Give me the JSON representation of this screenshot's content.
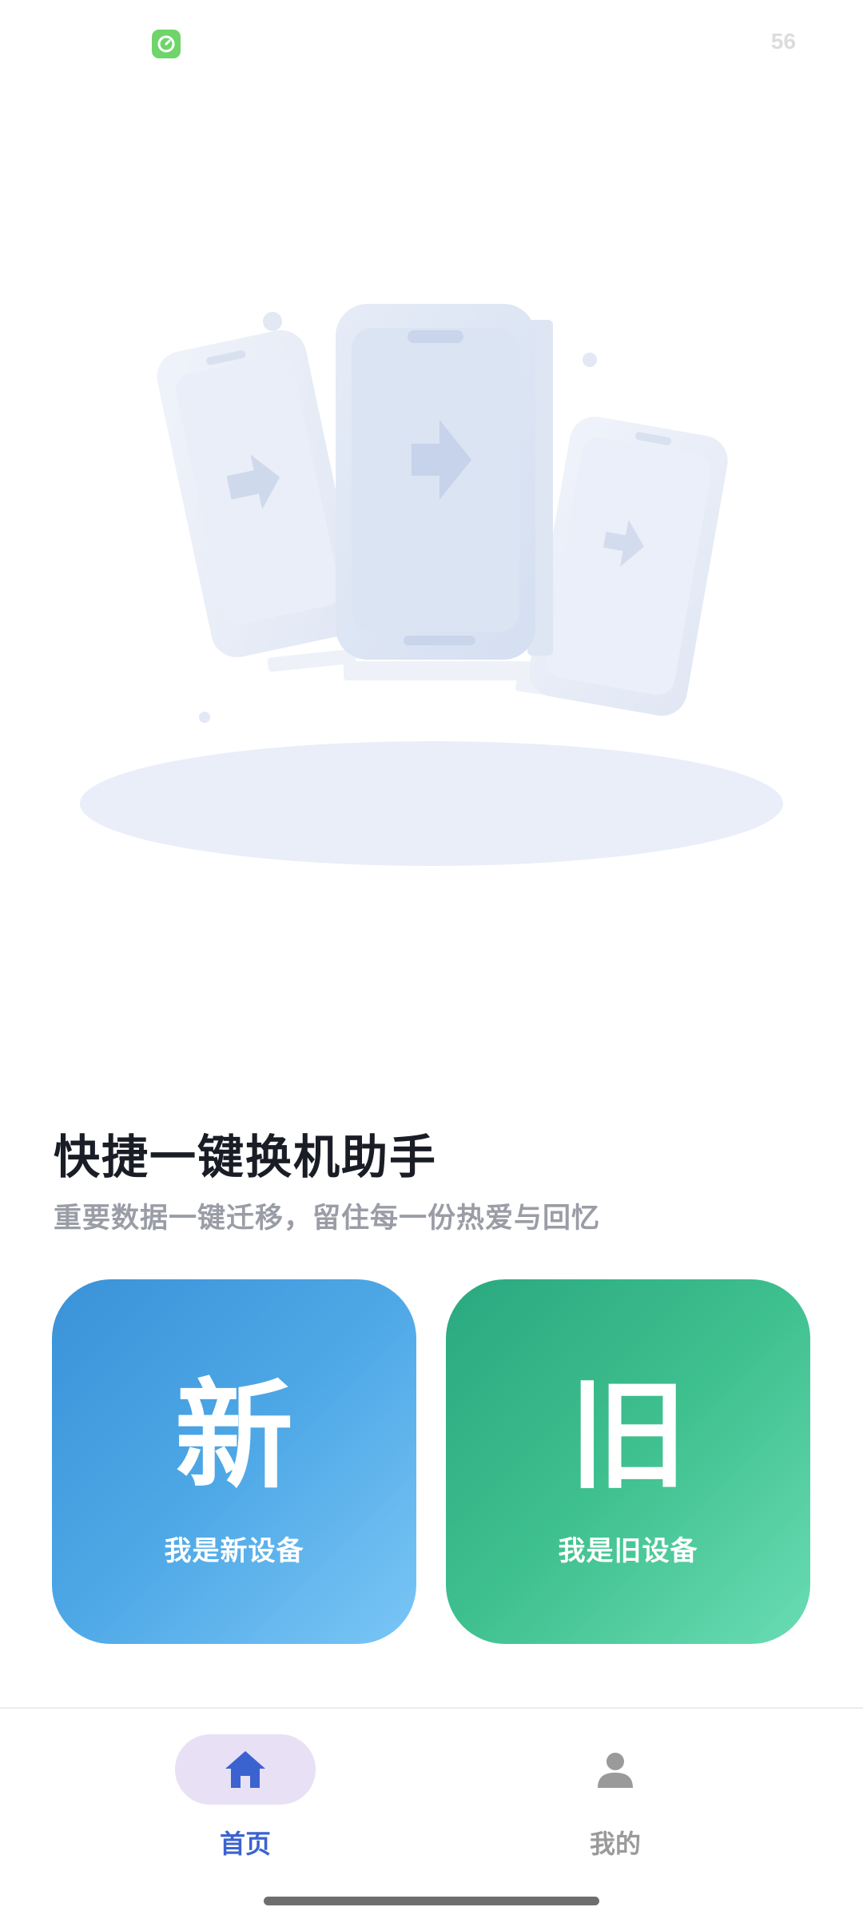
{
  "status_bar": {
    "battery": "56",
    "app_icon": "timer-app-icon"
  },
  "main": {
    "title": "快捷一键换机助手",
    "subtitle": "重要数据一键迁移，留住每一份热爱与回忆",
    "cards": [
      {
        "glyph": "新",
        "label": "我是新设备",
        "color": "#4ea8e6"
      },
      {
        "glyph": "旧",
        "label": "我是旧设备",
        "color": "#3fc08f"
      }
    ]
  },
  "bottom_nav": {
    "items": [
      {
        "label": "首页",
        "icon": "home-icon",
        "active": true
      },
      {
        "label": "我的",
        "icon": "person-icon",
        "active": false
      }
    ],
    "active_color": "#3b63d0",
    "inactive_color": "#9a9a9a"
  }
}
